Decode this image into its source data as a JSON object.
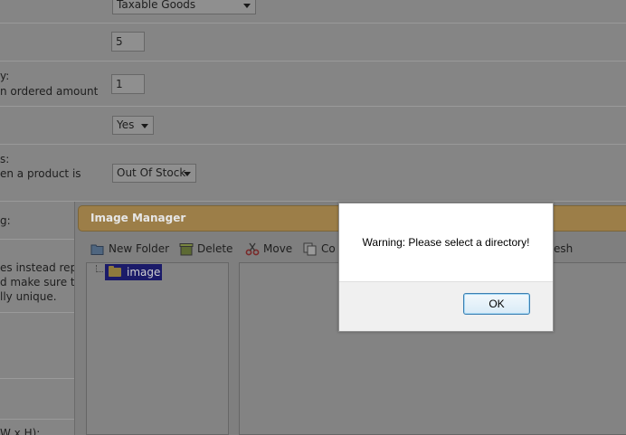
{
  "form": {
    "tax_class_value": "Taxable Goods",
    "quantity_value": "5",
    "minimum_label_1": "y:",
    "minimum_label_2": "n ordered amount",
    "minimum_value": "1",
    "subtract_value": "Yes",
    "stock_status_label_1": "s:",
    "stock_status_label_2": "en a product is",
    "stock_status_value": "Out Of Stock",
    "seo_label": "g:",
    "seo_note_1": "es instead repl",
    "seo_note_2": "d make sure th",
    "seo_note_3": "lly unique.",
    "dimensions_label": "W x H):"
  },
  "image_manager": {
    "title": "Image Manager",
    "toolbar": {
      "new_folder": "New Folder",
      "delete": "Delete",
      "move": "Move",
      "copy": "Co",
      "refresh": "esh"
    },
    "tree_root": "image"
  },
  "dialog": {
    "message": "Warning: Please select a directory!",
    "ok_label": "OK"
  }
}
